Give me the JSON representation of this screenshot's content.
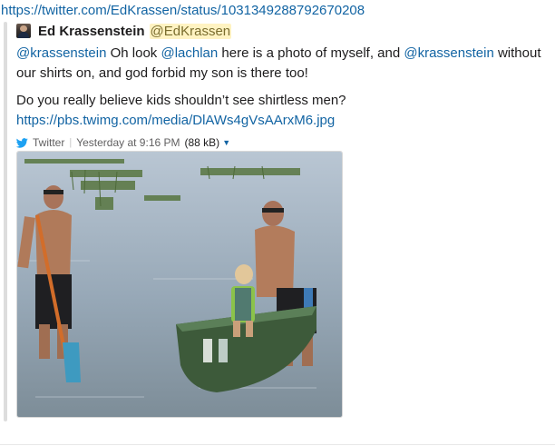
{
  "status_url": "https://twitter.com/EdKrassen/status/1031349288792670208",
  "author": {
    "name": "Ed Krassenstein",
    "handle": "@EdKrassen",
    "avatar_icon": "author-avatar"
  },
  "tweet": {
    "line1": {
      "mention_a": "@krassenstein",
      "text_a": " Oh look ",
      "mention_b": "@lachlan",
      "text_b": " here is a photo of myself, and ",
      "mention_c": "@krassenstein",
      "text_c": " without our shirts on, and god forbid my son is there too!"
    },
    "line2": "Do you really believe kids shouldn’t see shirtless men?",
    "media_link": "https://pbs.twimg.com/media/DlAWs4gVsAArxM6.jpg"
  },
  "meta": {
    "source": "Twitter",
    "timestamp": "Yesterday at 9:16 PM",
    "size": "(88 kB)",
    "source_icon": "twitter-bird-icon",
    "menu_icon": "caret-down-icon"
  },
  "photo": {
    "alt_name": "tweet-photo",
    "colors": {
      "sky": "#c2cedb",
      "water": "#8fa1b0",
      "reeds": "#5f7a4a",
      "boat": "#3f5a3c",
      "skin": "#b07a5a"
    }
  }
}
